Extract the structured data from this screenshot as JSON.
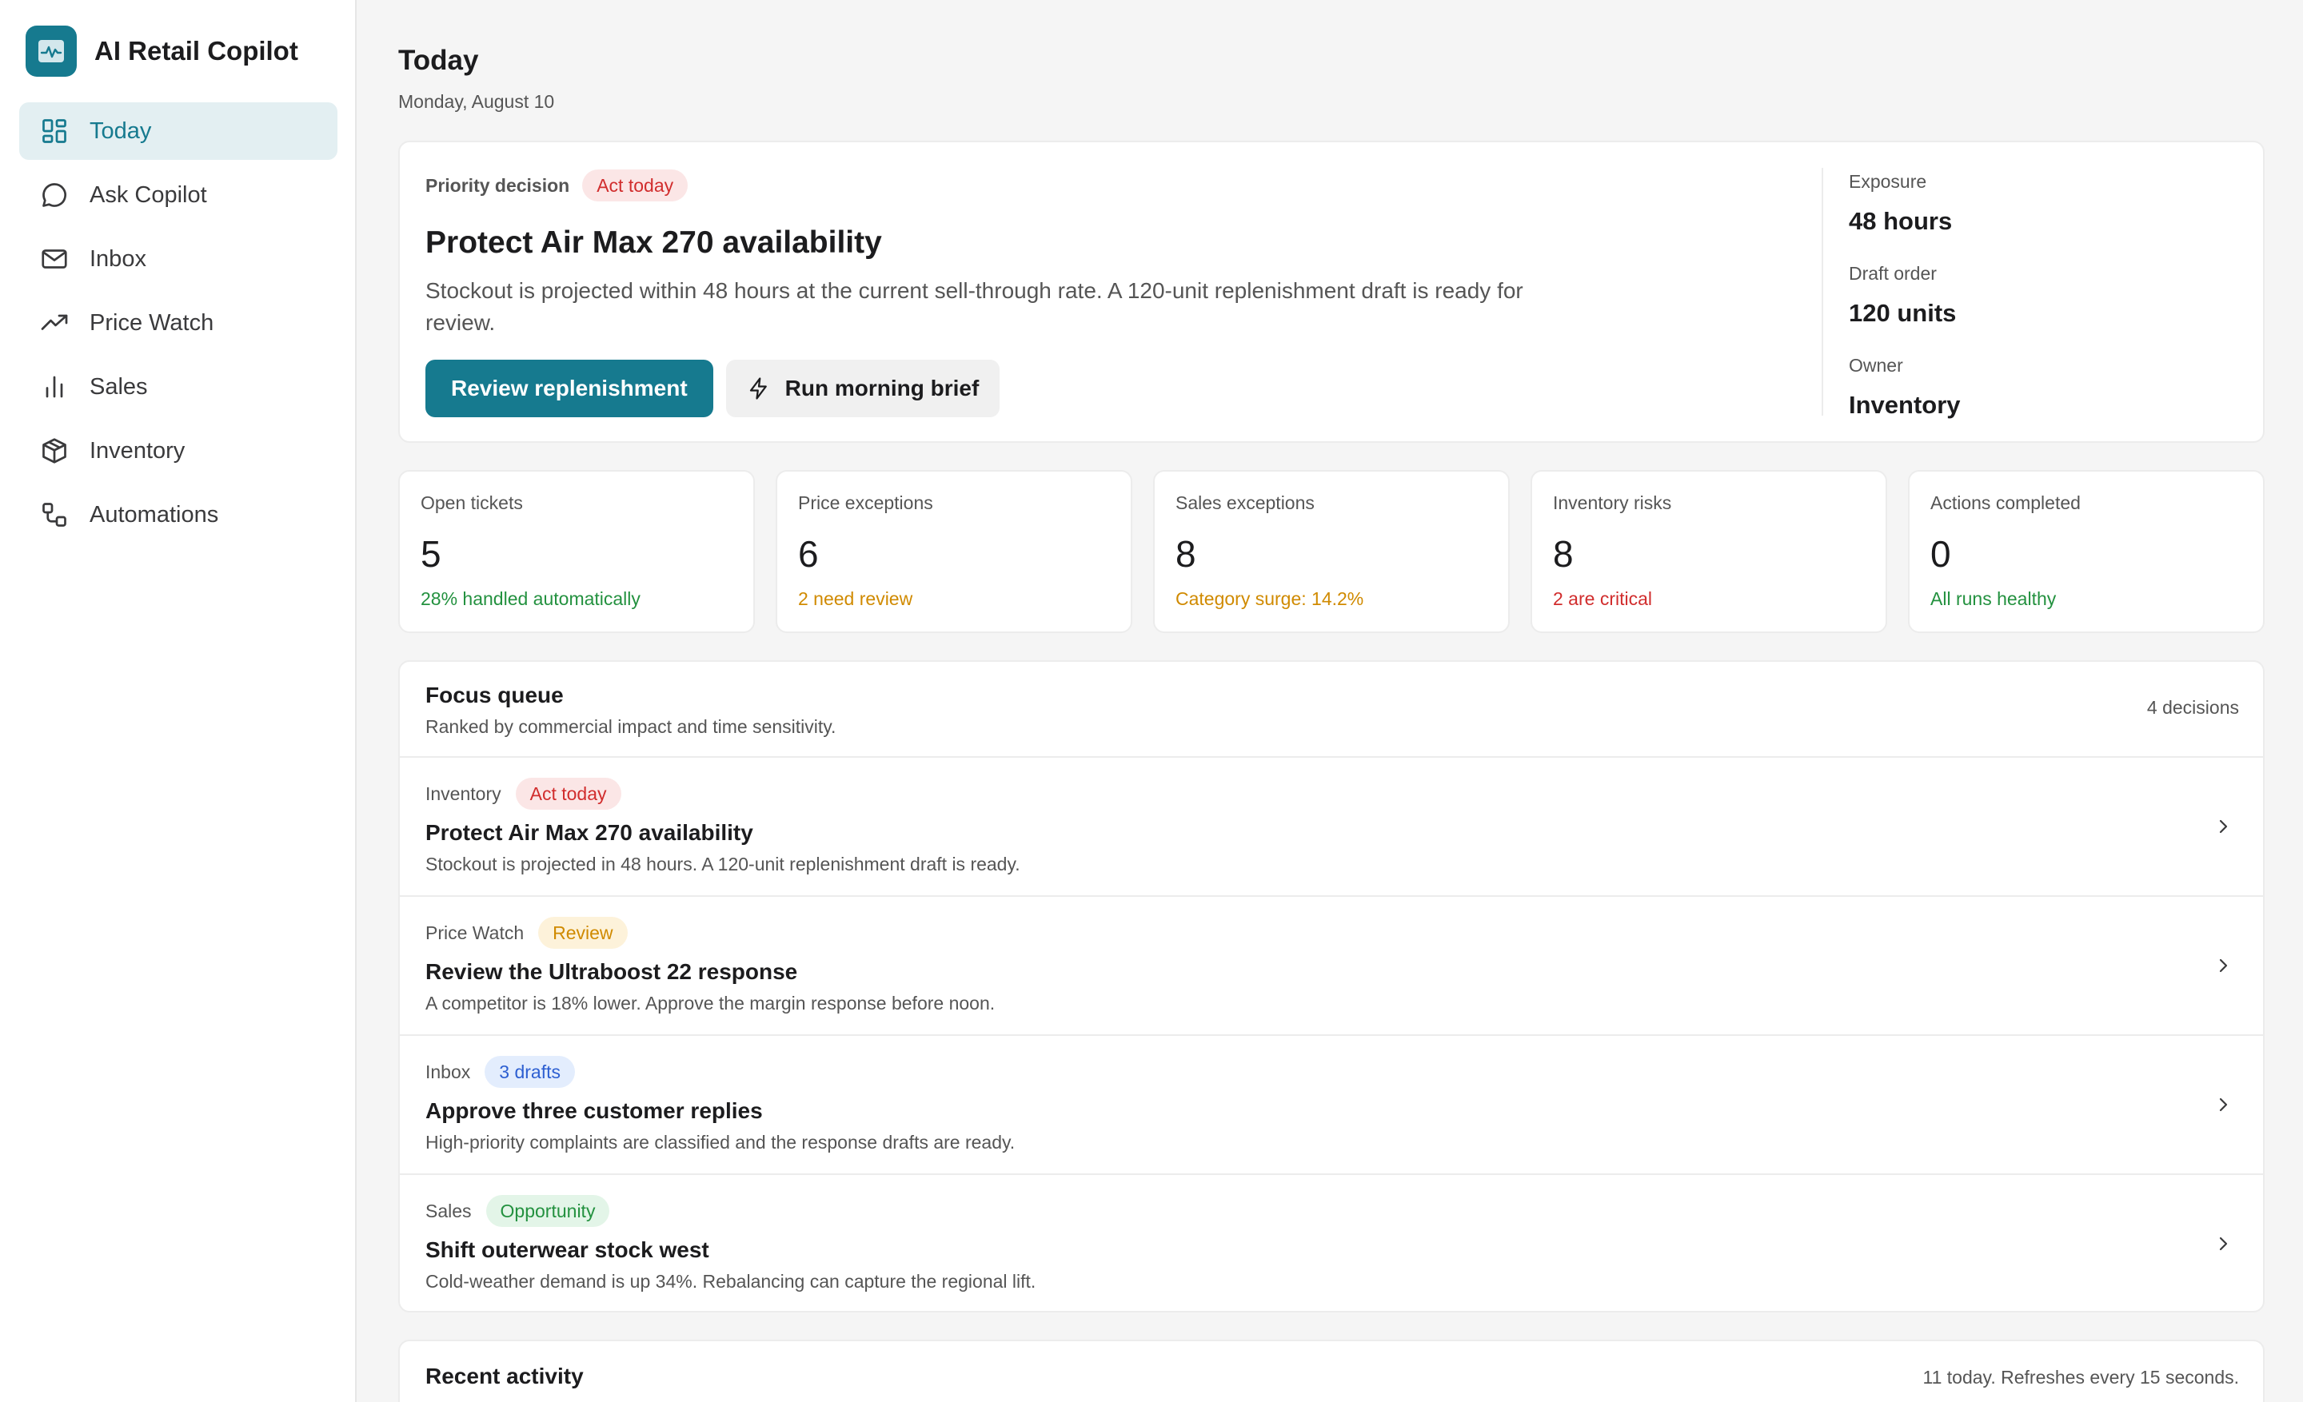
{
  "app": {
    "name": "AI Retail Copilot"
  },
  "sidebar": {
    "items": [
      {
        "label": "Today",
        "icon": "dashboard-icon",
        "active": true
      },
      {
        "label": "Ask Copilot",
        "icon": "chat-bubble-icon"
      },
      {
        "label": "Inbox",
        "icon": "mail-icon"
      },
      {
        "label": "Price Watch",
        "icon": "trending-up-icon"
      },
      {
        "label": "Sales",
        "icon": "bar-chart-icon"
      },
      {
        "label": "Inventory",
        "icon": "package-icon"
      },
      {
        "label": "Automations",
        "icon": "workflow-icon"
      }
    ]
  },
  "page": {
    "title": "Today",
    "date": "Monday, August 10"
  },
  "priority": {
    "kicker": "Priority decision",
    "badge": "Act today",
    "title": "Protect Air Max 270 availability",
    "description": "Stockout is projected within 48 hours at the current sell-through rate. A 120-unit replenishment draft is ready for review.",
    "primary_action": "Review replenishment",
    "secondary_action": "Run morning brief",
    "meta": [
      {
        "label": "Exposure",
        "value": "48 hours"
      },
      {
        "label": "Draft order",
        "value": "120 units"
      },
      {
        "label": "Owner",
        "value": "Inventory"
      }
    ]
  },
  "stats": [
    {
      "label": "Open tickets",
      "value": "5",
      "sub": "28% handled automatically",
      "tone": "green"
    },
    {
      "label": "Price exceptions",
      "value": "6",
      "sub": "2 need review",
      "tone": "amber"
    },
    {
      "label": "Sales exceptions",
      "value": "8",
      "sub": "Category surge: 14.2%",
      "tone": "amber"
    },
    {
      "label": "Inventory risks",
      "value": "8",
      "sub": "2 are critical",
      "tone": "red"
    },
    {
      "label": "Actions completed",
      "value": "0",
      "sub": "All runs healthy",
      "tone": "green"
    }
  ],
  "focus_queue": {
    "title": "Focus queue",
    "subtitle": "Ranked by commercial impact and time sensitivity.",
    "count": "4 decisions",
    "items": [
      {
        "category": "Inventory",
        "badge": "Act today",
        "badge_tone": "red",
        "title": "Protect Air Max 270 availability",
        "description": "Stockout is projected in 48 hours. A 120-unit replenishment draft is ready."
      },
      {
        "category": "Price Watch",
        "badge": "Review",
        "badge_tone": "amber",
        "title": "Review the Ultraboost 22 response",
        "description": "A competitor is 18% lower. Approve the margin response before noon."
      },
      {
        "category": "Inbox",
        "badge": "3 drafts",
        "badge_tone": "blue",
        "title": "Approve three customer replies",
        "description": "High-priority complaints are classified and the response drafts are ready."
      },
      {
        "category": "Sales",
        "badge": "Opportunity",
        "badge_tone": "green",
        "title": "Shift outerwear stock west",
        "description": "Cold-weather demand is up 34%. Rebalancing can capture the regional lift."
      }
    ]
  },
  "recent_activity": {
    "title": "Recent activity",
    "meta": "11 today. Refreshes every 15 seconds."
  },
  "colors": {
    "accent": "#167a8f",
    "accent_soft": "#e3eff2",
    "red": "#d12d2d",
    "amber": "#d08a00",
    "green": "#23913f",
    "blue": "#2d5fd1"
  }
}
